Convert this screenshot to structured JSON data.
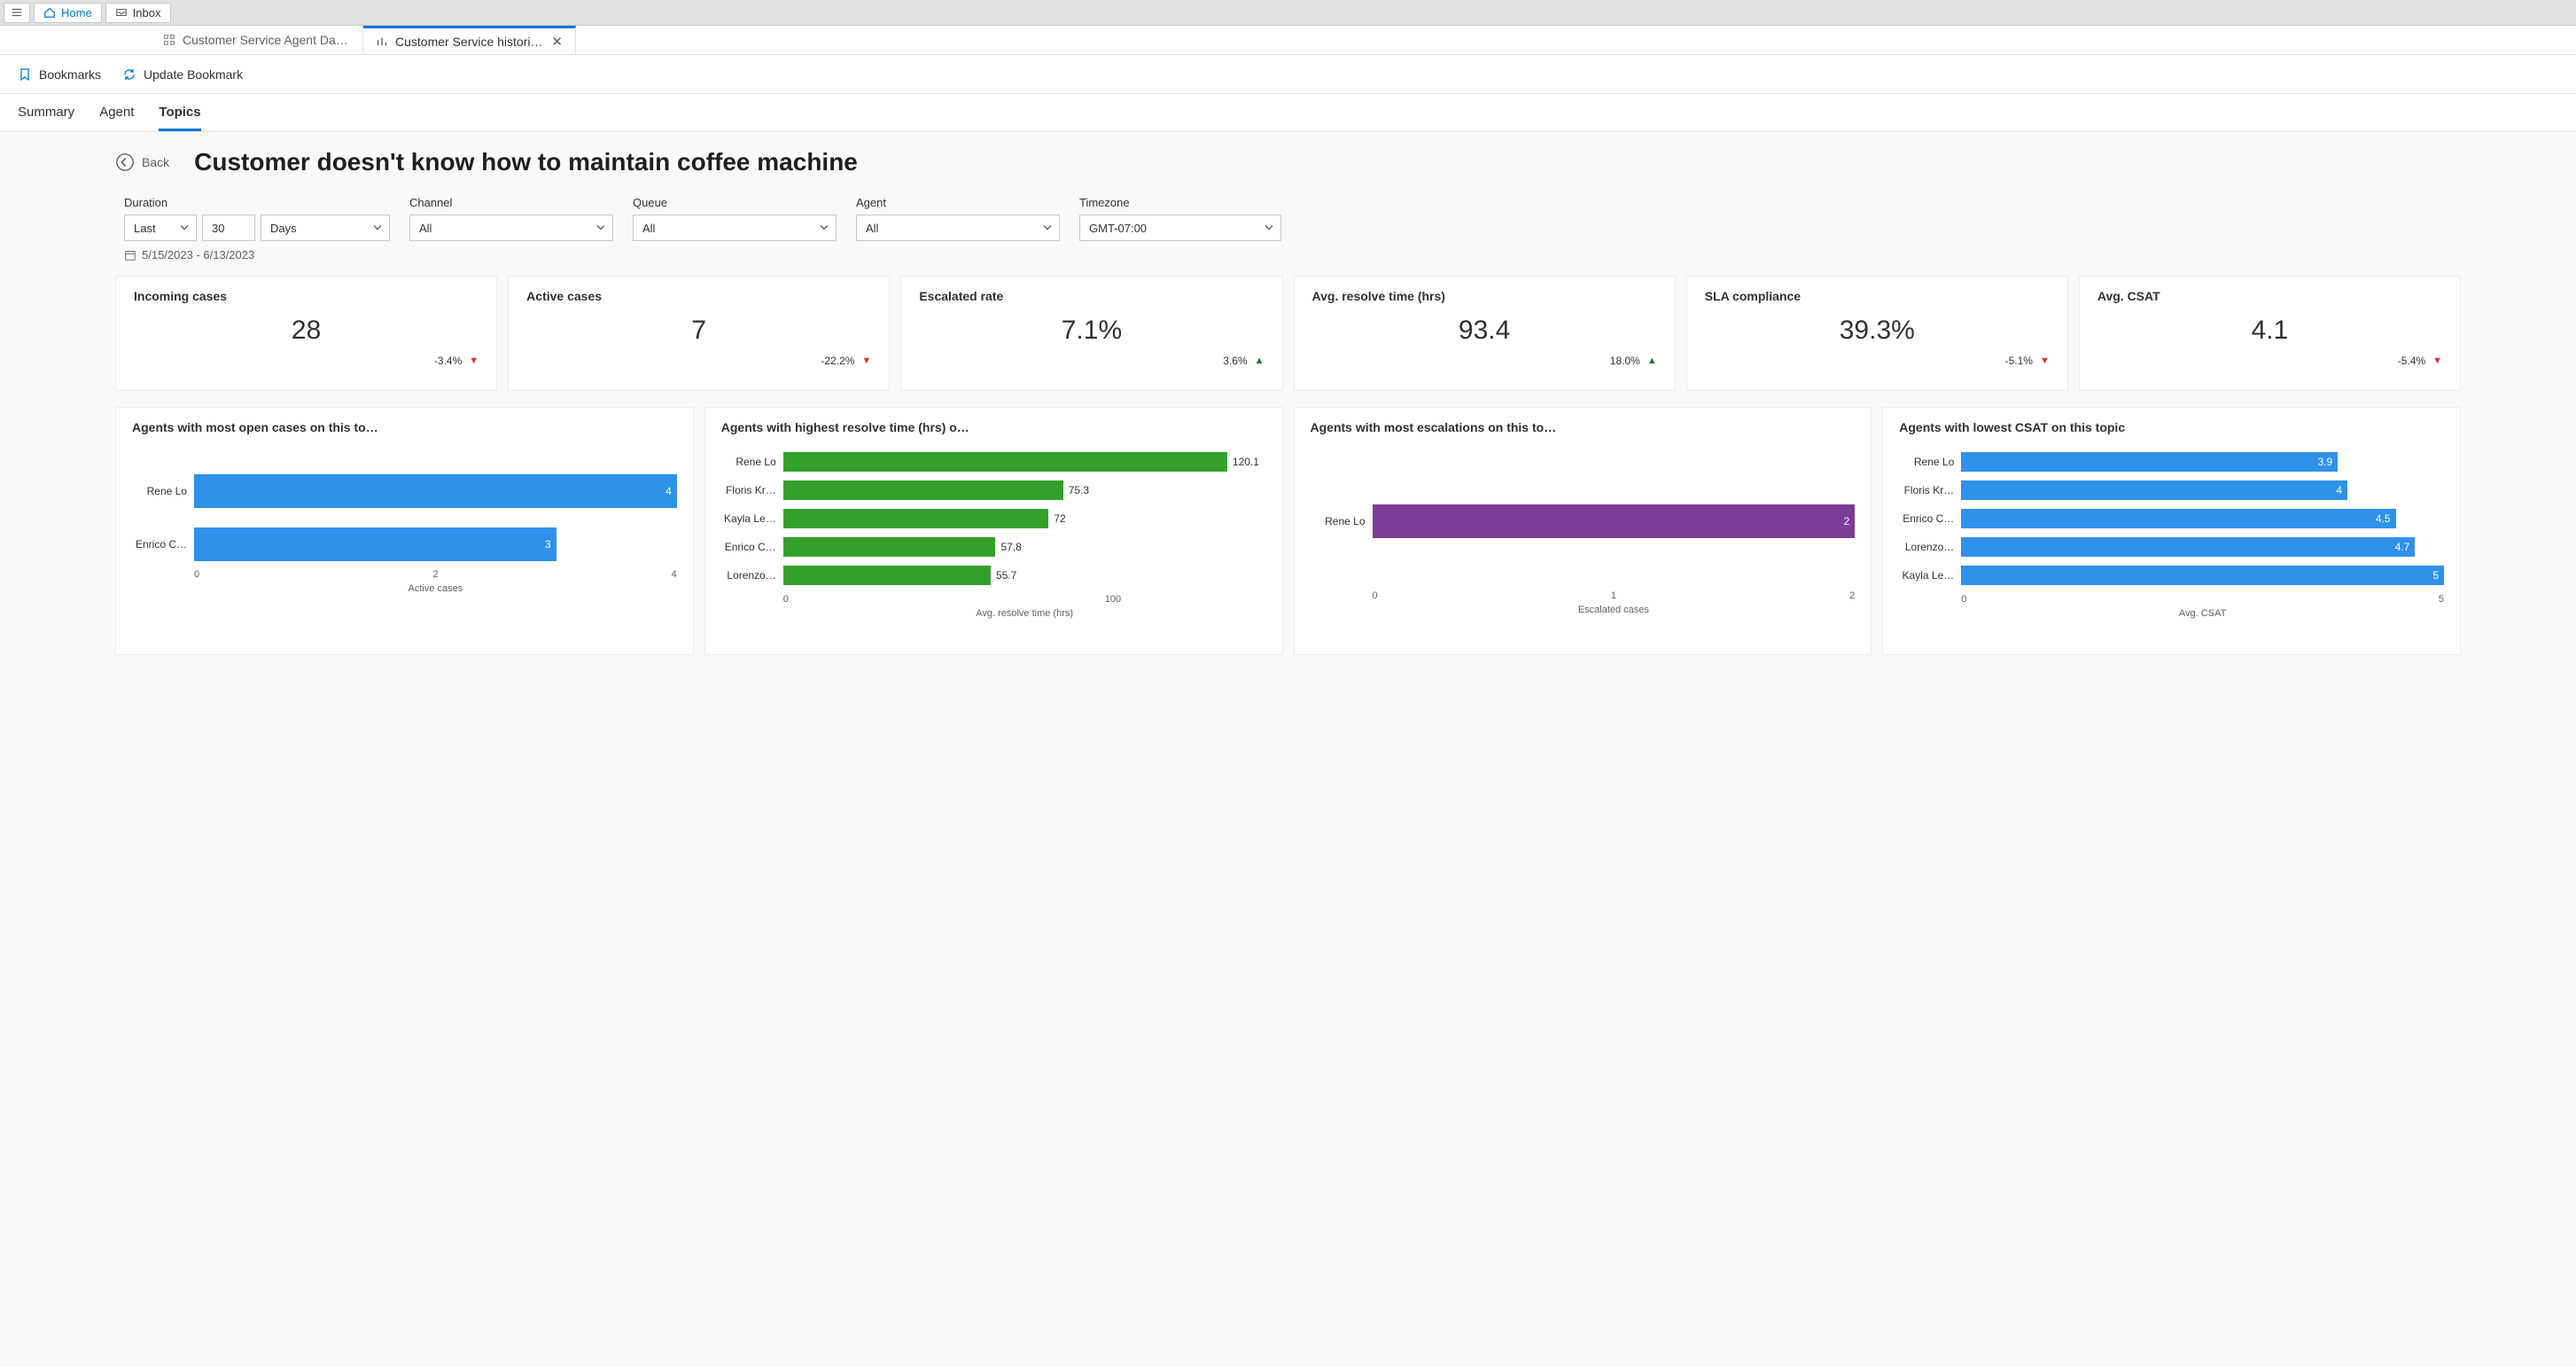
{
  "top": {
    "home": "Home",
    "inbox": "Inbox"
  },
  "tabs": {
    "dash": "Customer Service Agent Dash…",
    "hist": "Customer Service historica…"
  },
  "cmd": {
    "bookmarks": "Bookmarks",
    "update": "Update Bookmark"
  },
  "subnav": {
    "summary": "Summary",
    "agent": "Agent",
    "topics": "Topics"
  },
  "back": "Back",
  "title": "Customer doesn't know how to maintain coffee machine",
  "filters": {
    "duration_label": "Duration",
    "duration_mode": "Last",
    "duration_n": "30",
    "duration_unit": "Days",
    "channel_label": "Channel",
    "channel": "All",
    "queue_label": "Queue",
    "queue": "All",
    "agent_label": "Agent",
    "agent": "All",
    "tz_label": "Timezone",
    "tz": "GMT-07:00",
    "range": "5/15/2023 - 6/13/2023"
  },
  "kpi": [
    {
      "title": "Incoming cases",
      "value": "28",
      "delta": "-3.4%",
      "dir": "down"
    },
    {
      "title": "Active cases",
      "value": "7",
      "delta": "-22.2%",
      "dir": "down"
    },
    {
      "title": "Escalated rate",
      "value": "7.1%",
      "delta": "3.6%",
      "dir": "up"
    },
    {
      "title": "Avg. resolve time (hrs)",
      "value": "93.4",
      "delta": "18.0%",
      "dir": "up"
    },
    {
      "title": "SLA compliance",
      "value": "39.3%",
      "delta": "-5.1%",
      "dir": "down"
    },
    {
      "title": "Avg. CSAT",
      "value": "4.1",
      "delta": "-5.4%",
      "dir": "down"
    }
  ],
  "charts": {
    "open": {
      "title": "Agents with most open cases on this to…",
      "axis": "Active cases",
      "ticks": [
        "0",
        "2",
        "4"
      ]
    },
    "resolve": {
      "title": "Agents with highest resolve time (hrs) o…",
      "axis": "Avg. resolve time (hrs)",
      "ticks": [
        "0",
        "100"
      ]
    },
    "esc": {
      "title": "Agents with most escalations on this to…",
      "axis": "Escalated cases",
      "ticks": [
        "0",
        "1",
        "2"
      ]
    },
    "csat": {
      "title": "Agents with lowest CSAT on this topic",
      "axis": "Avg. CSAT",
      "ticks": [
        "0",
        "5"
      ]
    }
  },
  "chart_data": [
    {
      "type": "bar",
      "orientation": "horizontal",
      "title": "Agents with most open cases on this topic",
      "xlabel": "Active cases",
      "categories": [
        "Rene Lo",
        "Enrico C…"
      ],
      "values": [
        4,
        3
      ],
      "xlim": [
        0,
        4
      ],
      "color": "#2e91ea"
    },
    {
      "type": "bar",
      "orientation": "horizontal",
      "title": "Agents with highest resolve time (hrs) on this topic",
      "xlabel": "Avg. resolve time (hrs)",
      "categories": [
        "Rene Lo",
        "Floris Kr…",
        "Kayla Le…",
        "Enrico C…",
        "Lorenzo…"
      ],
      "values": [
        120.1,
        75.3,
        72.0,
        57.8,
        55.7
      ],
      "xlim": [
        0,
        130
      ],
      "color": "#33a02c"
    },
    {
      "type": "bar",
      "orientation": "horizontal",
      "title": "Agents with most escalations on this topic",
      "xlabel": "Escalated cases",
      "categories": [
        "Rene Lo"
      ],
      "values": [
        2
      ],
      "xlim": [
        0,
        2
      ],
      "color": "#7d3c98"
    },
    {
      "type": "bar",
      "orientation": "horizontal",
      "title": "Agents with lowest CSAT on this topic",
      "xlabel": "Avg. CSAT",
      "categories": [
        "Rene Lo",
        "Floris Kr…",
        "Enrico C…",
        "Lorenzo…",
        "Kayla Le…"
      ],
      "values": [
        3.9,
        4.0,
        4.5,
        4.7,
        5.0
      ],
      "xlim": [
        0,
        5
      ],
      "color": "#2e91ea"
    }
  ]
}
